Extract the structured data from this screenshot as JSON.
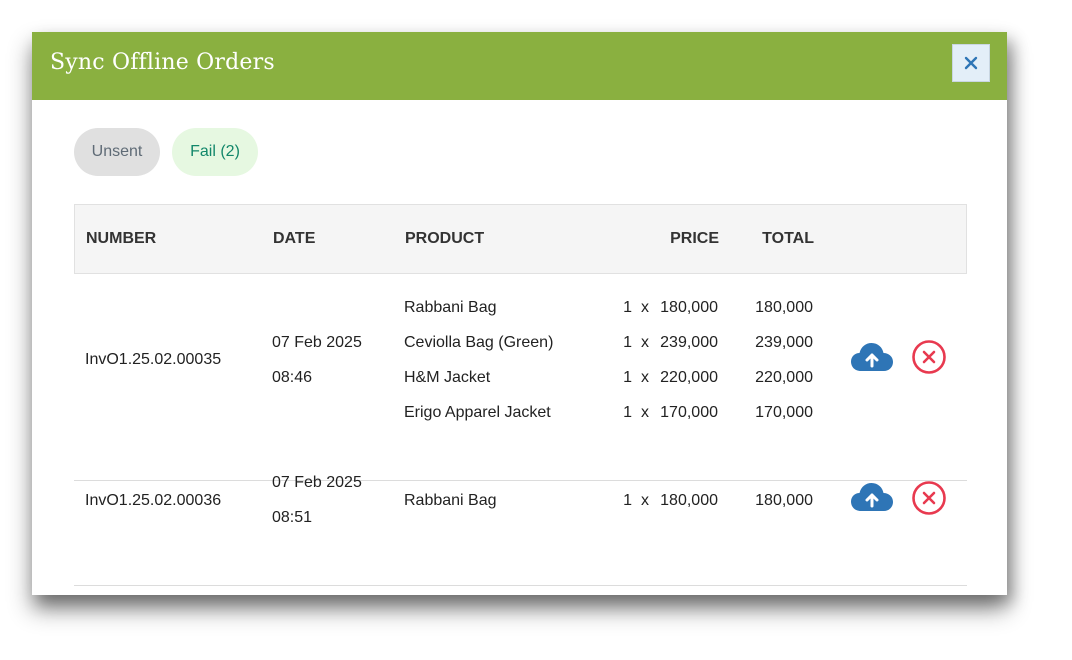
{
  "dialog": {
    "title": "Sync Offline Orders",
    "close_symbol": "✕"
  },
  "tabs": [
    {
      "label": "Unsent",
      "active": false
    },
    {
      "label": "Fail (2)",
      "active": true
    }
  ],
  "table": {
    "columns": [
      "NUMBER",
      "DATE",
      "PRODUCT",
      "PRICE",
      "TOTAL"
    ],
    "rows": [
      {
        "number": "InvO1.25.02.00035",
        "date": "07 Feb 2025",
        "time": "08:46",
        "items": [
          {
            "product": "Rabbani Bag",
            "qty": "1",
            "x": "x",
            "price": "180,000",
            "total": "180,000"
          },
          {
            "product": "Ceviolla Bag (Green)",
            "qty": "1",
            "x": "x",
            "price": "239,000",
            "total": "239,000"
          },
          {
            "product": "H&M Jacket",
            "qty": "1",
            "x": "x",
            "price": "220,000",
            "total": "220,000"
          },
          {
            "product": "Erigo Apparel Jacket",
            "qty": "1",
            "x": "x",
            "price": "170,000",
            "total": "170,000"
          }
        ]
      },
      {
        "number": "InvO1.25.02.00036",
        "date": "07 Feb 2025",
        "time": "08:51",
        "items": [
          {
            "product": "Rabbani Bag",
            "qty": "1",
            "x": "x",
            "price": "180,000",
            "total": "180,000"
          }
        ]
      }
    ]
  },
  "icons": {
    "upload": "cloud-upload-icon",
    "delete": "circle-x-icon"
  },
  "colors": {
    "header_bg": "#8ab040",
    "upload_icon": "#2e75b6",
    "delete_icon": "#e8394f",
    "fail_tab_bg": "#e6f8e1",
    "fail_tab_text": "#12876a"
  }
}
